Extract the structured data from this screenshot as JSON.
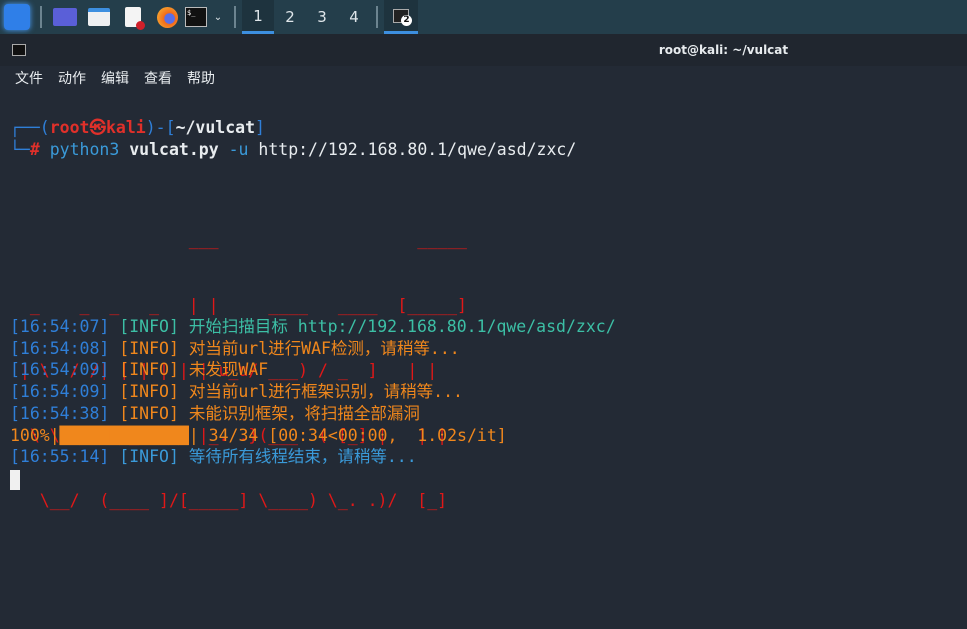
{
  "taskbar": {
    "workspaces": [
      "1",
      "2",
      "3",
      "4"
    ],
    "terminal_badge": "2",
    "colors": {
      "accent": "#3d8fe0"
    }
  },
  "window": {
    "title": "root@kali: ~/vulcat"
  },
  "menu": [
    "文件",
    "动作",
    "编辑",
    "查看",
    "帮助"
  ],
  "prompt": {
    "user": "root",
    "at": "㉿",
    "host": "kali",
    "dir": "~/vulcat",
    "hash": "#",
    "cmd": "python3",
    "script": "vulcat.py",
    "flag": "-u",
    "url": "http://192.168.80.1/qwe/asd/zxc/"
  },
  "ascii_art": [
    "                  ___                    _____",
    "  _    _  _   _   | |     ____   ____  [_____]",
    " | \\  / /| | | | | | u_u/ ___) / _  ]   | |",
    "  \\ \\/ / | (_/ | | |_. .}(___  ( [_] |   | |",
    "   \\__/  (____ ]/[_____] \\____) \\_. .)/  [_]"
  ],
  "logs": [
    {
      "time": "[16:54:07]",
      "level": "[INFO]",
      "msg": "开始扫描目标 http://192.168.80.1/qwe/asd/zxc/",
      "color": "teal"
    },
    {
      "time": "[16:54:08]",
      "level": "[INFO]",
      "msg": "对当前url进行WAF检测，请稍等...",
      "color": "orange"
    },
    {
      "time": "[16:54:09]",
      "level": "[INFO]",
      "msg": "未发现WAF",
      "color": "orange"
    },
    {
      "time": "[16:54:09]",
      "level": "[INFO]",
      "msg": "对当前url进行框架识别，请稍等...",
      "color": "orange"
    },
    {
      "time": "[16:54:38]",
      "level": "[INFO]",
      "msg": "未能识别框架，将扫描全部漏洞",
      "color": "orange"
    }
  ],
  "progress": {
    "percent_label": "100%|",
    "bar": "█████████████",
    "fraction": 1.0,
    "rest": "| 34/34 [00:34<00:00,  1.02s/it]"
  },
  "final_log": {
    "time": "[16:55:14]",
    "level": "[INFO]",
    "msg": "等待所有线程结束，请稍等..."
  }
}
